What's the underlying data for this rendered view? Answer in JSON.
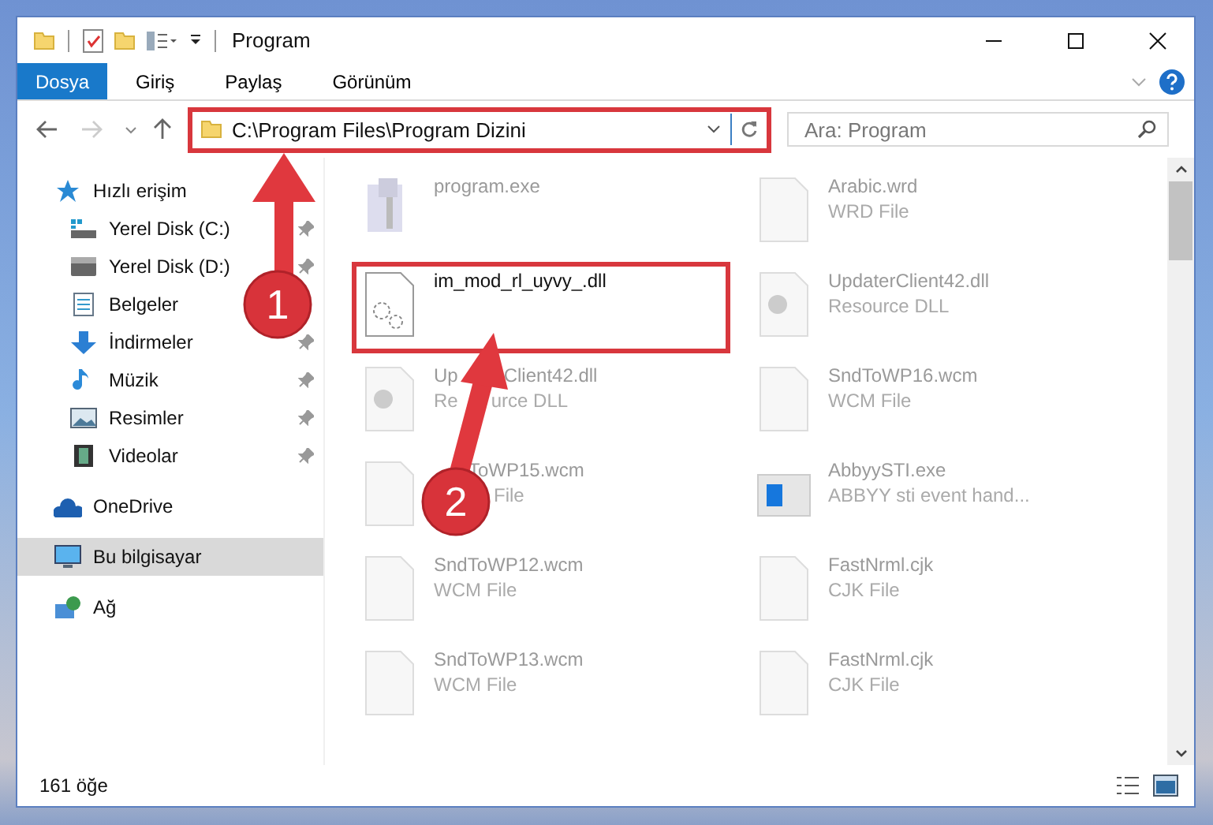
{
  "window": {
    "title": "Program"
  },
  "ribbon": {
    "tabs": [
      {
        "label": "Dosya",
        "kind": "menu"
      },
      {
        "label": "Giriş",
        "kind": "tab"
      },
      {
        "label": "Paylaş",
        "kind": "tab"
      },
      {
        "label": "Görünüm",
        "kind": "tab"
      }
    ]
  },
  "address": {
    "path": "C:\\Program Files\\Program Dizini",
    "highlighted": true
  },
  "search": {
    "placeholder": "Ara: Program"
  },
  "navigation": [
    {
      "label": "Hızlı erişim",
      "selected": false,
      "children": [
        {
          "label": "Yerel Disk (C:)",
          "pinned": true
        },
        {
          "label": "Yerel Disk (D:)",
          "pinned": true
        },
        {
          "label": "Belgeler"
        },
        {
          "label": "İndirmeler",
          "pinned": true
        },
        {
          "label": "Müzik",
          "pinned": true
        },
        {
          "label": "Resimler",
          "pinned": true
        },
        {
          "label": "Videolar",
          "pinned": true
        }
      ]
    },
    {
      "label": "OneDrive",
      "selected": false
    },
    {
      "label": "Bu bilgisayar",
      "selected": true
    },
    {
      "label": "Ağ",
      "selected": false
    }
  ],
  "files": [
    {
      "name_parts": [
        "program.exe"
      ],
      "dimmed": true,
      "highlighted": false
    },
    {
      "name_parts": [
        "Arabic.wrd"
      ],
      "type_parts": [
        "WRD File"
      ],
      "dimmed": true,
      "highlighted": false
    },
    {
      "name_parts": [
        "im_mod_rl_uyvy_.dll"
      ],
      "dimmed": false,
      "highlighted": true
    },
    {
      "name_parts": [
        "UpdaterClient42.dll"
      ],
      "type_parts": [
        "Resource DLL"
      ],
      "dimmed": true,
      "highlighted": false
    },
    {
      "name_parts": [
        "Up",
        "Client42.dll"
      ],
      "type_parts": [
        "Re",
        "urce DLL"
      ],
      "dimmed": true,
      "highlighted": false
    },
    {
      "name_parts": [
        "SndToWP16.wcm"
      ],
      "type_parts": [
        "WCM File"
      ],
      "dimmed": true,
      "highlighted": false
    },
    {
      "name_parts": [
        "ToWP15.wcm"
      ],
      "type_parts": [
        "File"
      ],
      "dimmed": true,
      "highlighted": false
    },
    {
      "name_parts": [
        "AbbyySTI.exe"
      ],
      "type_parts": [
        "ABBYY sti event hand..."
      ],
      "dimmed": true,
      "highlighted": false
    },
    {
      "name_parts": [
        "SndToWP12.wcm"
      ],
      "type_parts": [
        "WCM File"
      ],
      "dimmed": true,
      "highlighted": false
    },
    {
      "name_parts": [
        "FastNrml.cjk"
      ],
      "type_parts": [
        "CJK File"
      ],
      "dimmed": true,
      "highlighted": false
    },
    {
      "name_parts": [
        "SndToWP13.wcm"
      ],
      "type_parts": [
        "WCM File"
      ],
      "dimmed": true,
      "highlighted": false
    },
    {
      "name_parts": [
        "FastNrml.cjk"
      ],
      "type_parts": [
        "CJK File"
      ],
      "dimmed": true,
      "highlighted": false
    }
  ],
  "status_bar": {
    "item_count": "161 öğe"
  },
  "annotations": [
    {
      "number": "1"
    },
    {
      "number": "2"
    }
  ]
}
